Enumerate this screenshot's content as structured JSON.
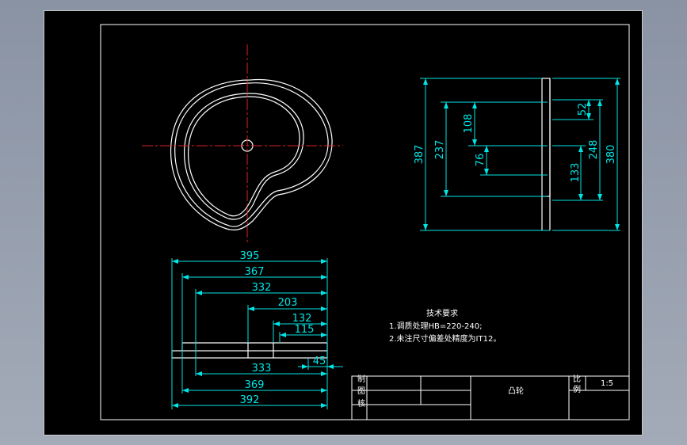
{
  "colors": {
    "background": "#000000",
    "geometry": "#ffffff",
    "dimension": "#00e5e5",
    "centerline": "#e02020",
    "frame": "#ffffff"
  },
  "side_view": {
    "dims": [
      "387",
      "237",
      "108",
      "76",
      "52",
      "248",
      "133",
      "380"
    ]
  },
  "bottom_view": {
    "dims_top": [
      "395",
      "367",
      "332",
      "203",
      "132",
      "115"
    ],
    "dims_bottom": [
      "45",
      "333",
      "369",
      "392"
    ]
  },
  "notes": {
    "title": "技术要求",
    "line1": "1.调质处理HB=220-240;",
    "line2": "2.未注尺寸偏差处精度为IT12。"
  },
  "title_block": {
    "part_name": "凸轮",
    "label_make": "制",
    "label_draw": "图",
    "label_check": "核",
    "label_ratio_top": "比",
    "label_ratio_bottom": "例",
    "scale": "1:5"
  }
}
